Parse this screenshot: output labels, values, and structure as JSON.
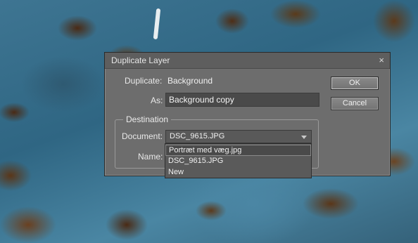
{
  "dialog": {
    "title": "Duplicate Layer",
    "close_glyph": "×",
    "duplicate_label": "Duplicate:",
    "duplicate_value": "Background",
    "as_label": "As:",
    "as_value": "Background copy",
    "ok_label": "OK",
    "cancel_label": "Cancel",
    "destination": {
      "legend": "Destination",
      "document_label": "Document:",
      "document_value": "DSC_9615.JPG",
      "name_label": "Name:",
      "options": [
        "Portræt med væg.jpg",
        "DSC_9615.JPG",
        "New"
      ],
      "highlighted_option": "Portræt med væg.jpg"
    }
  }
}
